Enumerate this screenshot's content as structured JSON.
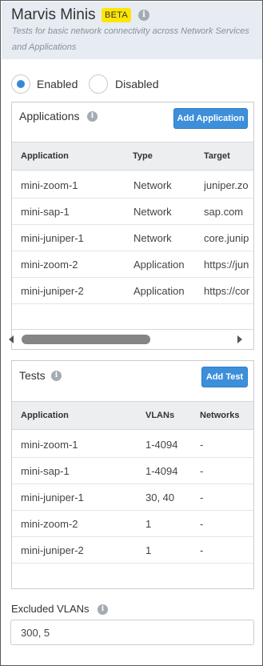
{
  "header": {
    "title": "Marvis Minis",
    "badge": "BETA",
    "subtitle": "Tests for basic network connectivity across Network Services and Applications",
    "info_icon": "info-icon"
  },
  "status": {
    "enabled_label": "Enabled",
    "disabled_label": "Disabled",
    "selected": "Enabled"
  },
  "applications": {
    "title": "Applications",
    "add_button": "Add Application",
    "columns": [
      "Application",
      "Type",
      "Target"
    ],
    "rows": [
      {
        "application": "mini-zoom-1",
        "type": "Network",
        "target": "juniper.zo"
      },
      {
        "application": "mini-sap-1",
        "type": "Network",
        "target": "sap.com"
      },
      {
        "application": "mini-juniper-1",
        "type": "Network",
        "target": "core.junip"
      },
      {
        "application": "mini-zoom-2",
        "type": "Application",
        "target": "https://jun"
      },
      {
        "application": "mini-juniper-2",
        "type": "Application",
        "target": "https://cor"
      }
    ]
  },
  "tests": {
    "title": "Tests",
    "add_button": "Add Test",
    "columns": [
      "Application",
      "VLANs",
      "Networks"
    ],
    "rows": [
      {
        "application": "mini-zoom-1",
        "vlans": "1-4094",
        "networks": "-"
      },
      {
        "application": "mini-sap-1",
        "vlans": "1-4094",
        "networks": "-"
      },
      {
        "application": "mini-juniper-1",
        "vlans": "30, 40",
        "networks": "-"
      },
      {
        "application": "mini-zoom-2",
        "vlans": "1",
        "networks": "-"
      },
      {
        "application": "mini-juniper-2",
        "vlans": "1",
        "networks": "-"
      }
    ]
  },
  "excluded_vlans": {
    "label": "Excluded VLANs",
    "value": "300, 5"
  },
  "colors": {
    "accent": "#3d8fda",
    "badge": "#ffe600",
    "header_bg": "#e6ecf2"
  }
}
